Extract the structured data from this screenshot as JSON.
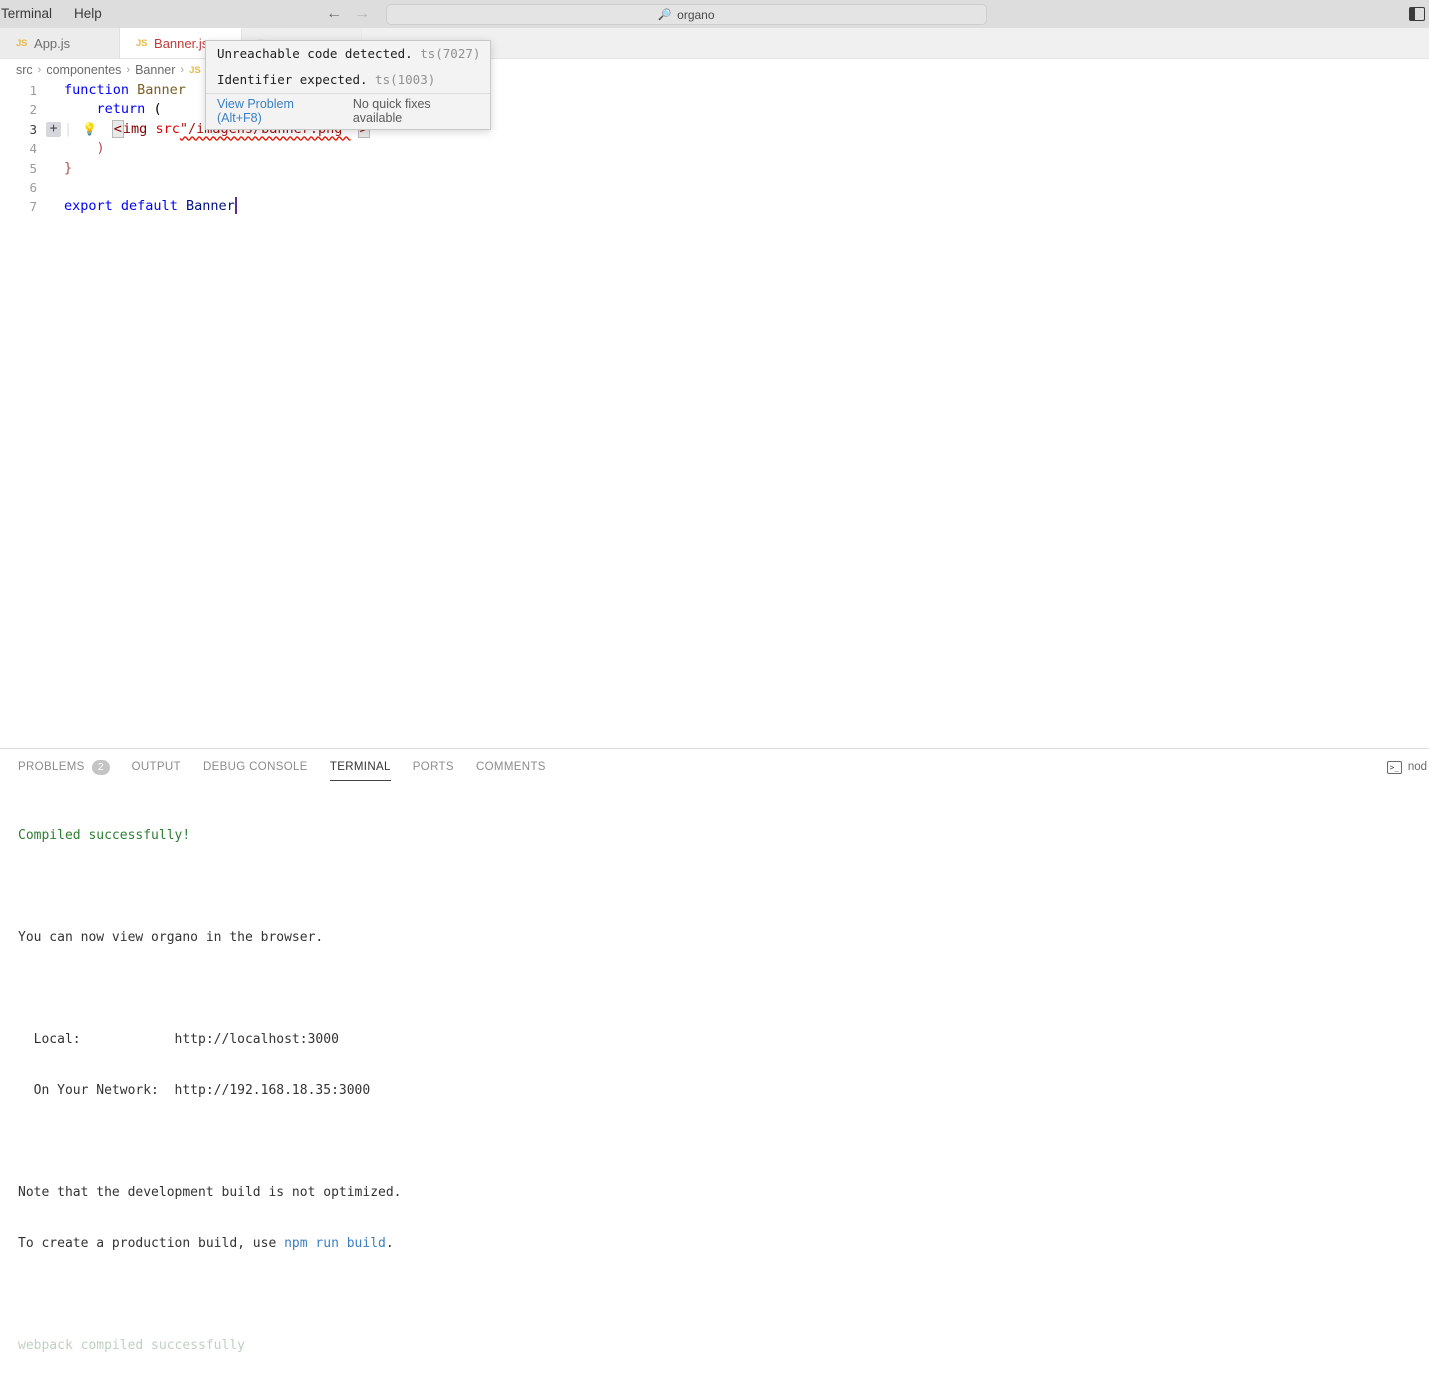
{
  "titlebar": {
    "menu": [
      {
        "label": "Terminal"
      },
      {
        "label": "Help"
      }
    ],
    "nav_back": "←",
    "nav_forward": "→",
    "command_center": {
      "search_icon": "search-icon",
      "text": "organo"
    },
    "layout_icons": [
      {
        "name": "toggle-primary-sidebar-icon"
      },
      {
        "name": "toggle-panel-icon"
      }
    ]
  },
  "tabs": [
    {
      "icon": "js-file-icon",
      "icon_text": "JS",
      "label": "App.js",
      "active": false,
      "error": false
    },
    {
      "icon": "js-file-icon",
      "icon_text": "JS",
      "label": "Banner.js",
      "active": true,
      "error": true
    },
    {
      "icon": "file-icon",
      "icon_text": "□",
      "label": "",
      "active": false,
      "error": false
    }
  ],
  "breadcrumb": {
    "items": [
      "src",
      "componentes",
      "Banner"
    ],
    "separator": "›",
    "trailing_icon": "js-file-icon"
  },
  "editor": {
    "lines": [
      {
        "num": "1",
        "tokens": [
          {
            "t": "kw",
            "v": "function"
          },
          {
            "t": "plain",
            "v": " "
          },
          {
            "t": "fn",
            "v": "Banner"
          }
        ]
      },
      {
        "num": "2",
        "tokens": [
          {
            "t": "plain",
            "v": "    "
          },
          {
            "t": "kw",
            "v": "return"
          },
          {
            "t": "plain",
            "v": " "
          },
          {
            "t": "punct",
            "v": "("
          }
        ]
      },
      {
        "num": "3",
        "tokens": []
      },
      {
        "num": "4",
        "tokens": [
          {
            "t": "brk-red",
            "v": "    )"
          }
        ]
      },
      {
        "num": "5",
        "tokens": [
          {
            "t": "brk-red",
            "v": "}"
          }
        ]
      },
      {
        "num": "6",
        "tokens": []
      },
      {
        "num": "7",
        "tokens": [
          {
            "t": "kw",
            "v": "export"
          },
          {
            "t": "plain",
            "v": " "
          },
          {
            "t": "kw",
            "v": "default"
          },
          {
            "t": "plain",
            "v": " "
          },
          {
            "t": "var",
            "v": "Banner"
          }
        ]
      }
    ],
    "line3": {
      "open_bracket": "<",
      "tag": "img",
      "attr": "src",
      "string": "\"/imagens/banner.png\"",
      "close_bracket": ">",
      "lightbulb": "quick-fix-lightbulb-icon",
      "fold_plus": "+"
    },
    "active_line": "3"
  },
  "hover_popup": {
    "problems": [
      {
        "message": "Unreachable code detected.",
        "code": "ts(7027)"
      },
      {
        "message": "Identifier expected.",
        "code": "ts(1003)"
      }
    ],
    "action_link": "View Problem (Alt+F8)",
    "action_note": "No quick fixes available"
  },
  "panel": {
    "tabs": [
      {
        "label": "PROBLEMS",
        "count": "2",
        "active": false
      },
      {
        "label": "OUTPUT",
        "count": null,
        "active": false
      },
      {
        "label": "DEBUG CONSOLE",
        "count": null,
        "active": false
      },
      {
        "label": "TERMINAL",
        "count": null,
        "active": true
      },
      {
        "label": "PORTS",
        "count": null,
        "active": false
      },
      {
        "label": "COMMENTS",
        "count": null,
        "active": false
      }
    ],
    "terminal_chip": {
      "icon": "terminal-node-icon",
      "icon_glyph": ">_",
      "label": "nod"
    },
    "terminal_output": [
      {
        "text": "Compiled successfully!",
        "style": "green"
      },
      {
        "text": "",
        "style": "plain"
      },
      {
        "text": "You can now view organo in the browser.",
        "style": "plain"
      },
      {
        "text": "",
        "style": "plain"
      },
      {
        "text": "  Local:            http://localhost:3000",
        "style": "plain"
      },
      {
        "text": "  On Your Network:  http://192.168.18.35:3000",
        "style": "plain"
      },
      {
        "text": "",
        "style": "plain"
      },
      {
        "text": "Note that the development build is not optimized.",
        "style": "plain"
      },
      {
        "text": "To create a production build, use ",
        "style": "plain",
        "suffix_link": "npm run build",
        "suffix_after": "."
      },
      {
        "text": "",
        "style": "plain"
      },
      {
        "text": "webpack compiled successfully",
        "style": "fade"
      }
    ]
  },
  "colors": {
    "accent_link": "#3b7fc4",
    "error_red": "#e51400",
    "success_green": "#2f7d32",
    "tab_error": "#c23b3b",
    "cursor_purple": "#5c2d91"
  }
}
